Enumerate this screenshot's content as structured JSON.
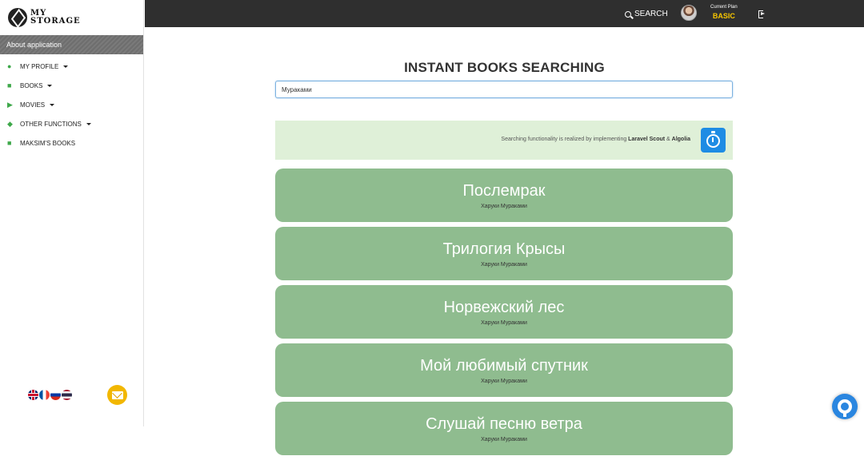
{
  "sidebar": {
    "logo_line1": "MY",
    "logo_line2": "STORAGE",
    "about_label": "About application",
    "items": [
      {
        "label": "MY PROFILE",
        "icon": "user-icon",
        "has_dropdown": true
      },
      {
        "label": "BOOKS",
        "icon": "book-icon",
        "has_dropdown": true
      },
      {
        "label": "MOVIES",
        "icon": "video-camera-icon",
        "has_dropdown": true
      },
      {
        "label": "OTHER FUNCTIONS",
        "icon": "ethereum-icon",
        "has_dropdown": true
      },
      {
        "label": "MAKSIM'S BOOKS",
        "icon": "book-icon",
        "has_dropdown": false
      }
    ],
    "languages": [
      "en",
      "fr",
      "ru",
      "th"
    ]
  },
  "topbar": {
    "search_label": "SEARCH",
    "plan_label": "Current Plan",
    "plan_value": "BASIC"
  },
  "main": {
    "title": "INSTANT BOOKS SEARCHING",
    "search_value": "Мураками",
    "info_prefix": "Searching functionality is realized by implementing ",
    "info_tech1": "Laravel Scout",
    "info_amp": " & ",
    "info_tech2": "Algolia",
    "books": [
      {
        "title": "Послемрак",
        "author": "Харуки Мураками"
      },
      {
        "title": "Трилогия Крысы",
        "author": "Харуки Мураками"
      },
      {
        "title": "Норвежский лес",
        "author": "Харуки Мураками"
      },
      {
        "title": "Мой любимый спутник",
        "author": "Харуки Мураками"
      },
      {
        "title": "Слушай песню ветра",
        "author": "Харуки Мураками"
      }
    ]
  },
  "colors": {
    "topbar": "#2f2f2f",
    "card": "#8fbc8f",
    "info_box": "#dff0d8",
    "accent_blue": "#1e8ce4",
    "plan_yellow": "#f7c600",
    "icon_green": "#3ea84a"
  }
}
